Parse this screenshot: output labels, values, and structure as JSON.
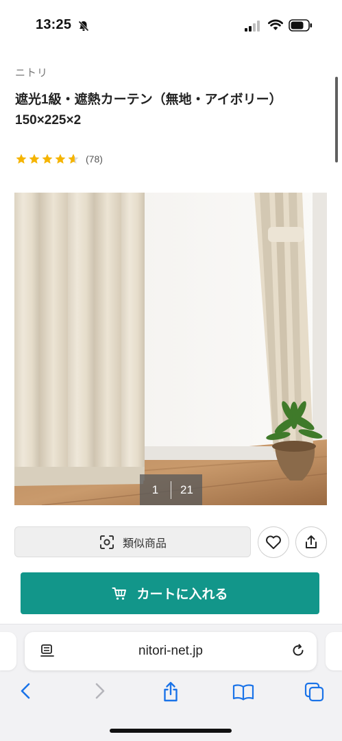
{
  "status_bar": {
    "time": "13:25"
  },
  "product": {
    "brand": "ニトリ",
    "title_line1": "遮光1級・遮熱カーテン（無地・アイボリー）",
    "title_line2": "150×225×2",
    "rating_value": 4.6,
    "review_count": "(78)"
  },
  "gallery": {
    "current": "1",
    "total": "21"
  },
  "actions": {
    "similar_label": "類似商品",
    "cart_label": "カートに入れる"
  },
  "browser": {
    "url": "nitori-net.jp"
  },
  "colors": {
    "accent": "#12968a",
    "star": "#f5b400",
    "ios_blue": "#1a73e8"
  }
}
